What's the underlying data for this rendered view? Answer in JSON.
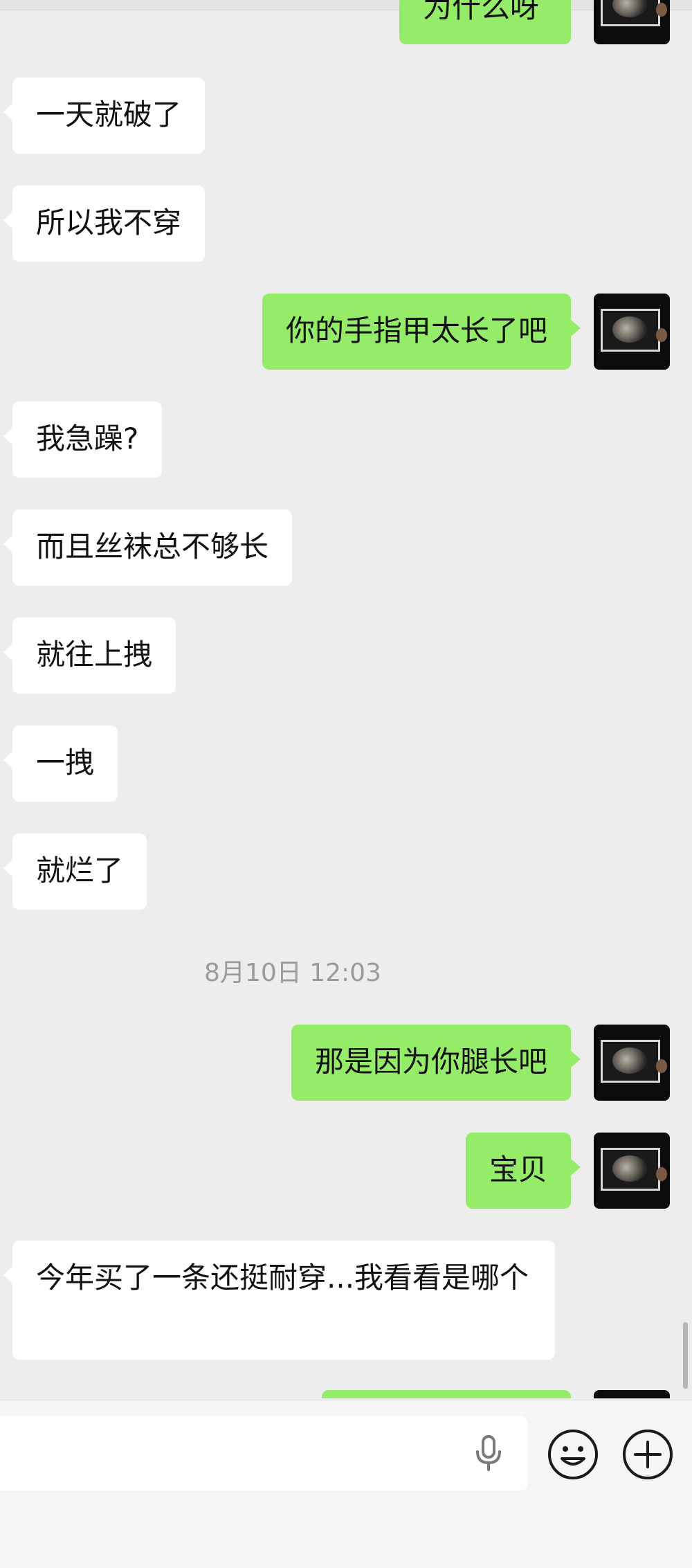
{
  "messages": [
    {
      "side": "out",
      "text": "为什么呀",
      "partial": true
    },
    {
      "side": "in",
      "text": "一天就破了"
    },
    {
      "side": "in",
      "text": "所以我不穿"
    },
    {
      "side": "out",
      "text": "你的手指甲太长了吧"
    },
    {
      "side": "in",
      "text": "我急躁?"
    },
    {
      "side": "in",
      "text": "而且丝袜总不够长"
    },
    {
      "side": "in",
      "text": "就往上拽"
    },
    {
      "side": "in",
      "text": "一拽"
    },
    {
      "side": "in",
      "text": "就烂了"
    },
    {
      "side": "out",
      "text": "那是因为你腿长吧"
    },
    {
      "side": "out",
      "text": "宝贝"
    },
    {
      "side": "in",
      "text": "今年买了一条还挺耐穿...我看看是哪个"
    },
    {
      "side": "out",
      "text": "",
      "partial": true
    }
  ],
  "timestamp": "8月10日 12:03",
  "input": {
    "placeholder": "",
    "mic_icon": "microphone-icon",
    "emoji_icon": "emoji-icon",
    "plus_icon": "plus-icon"
  },
  "colors": {
    "background": "#ededed",
    "outgoing": "#95ec69",
    "incoming": "#ffffff",
    "timestamp": "#9a9a9a"
  }
}
